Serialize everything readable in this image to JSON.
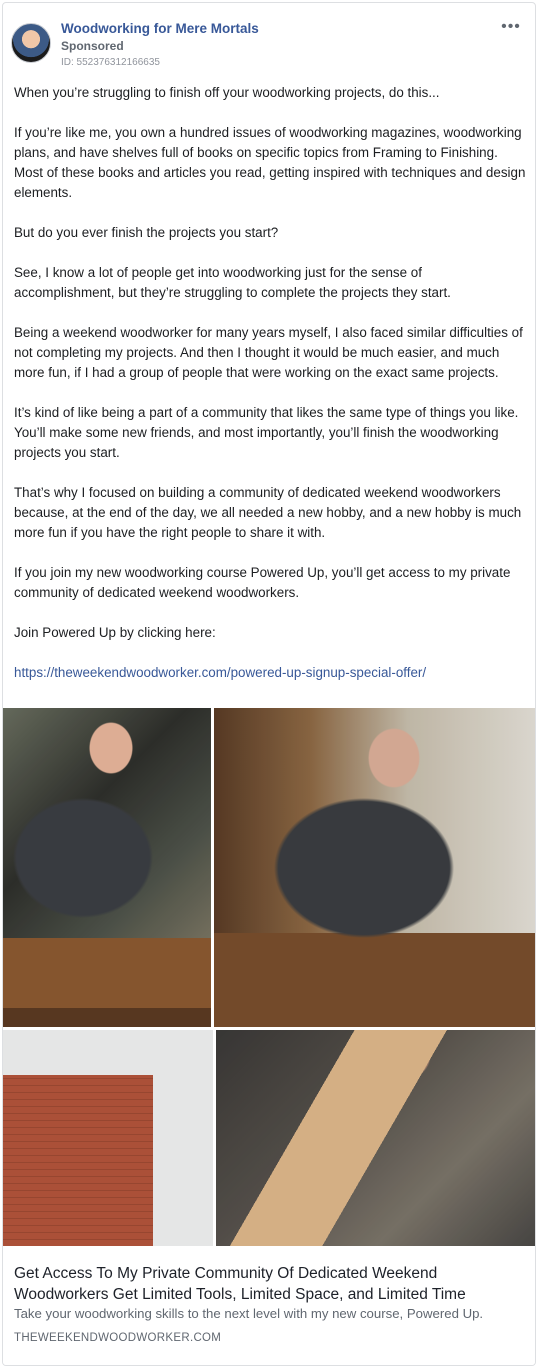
{
  "header": {
    "page_name": "Woodworking for Mere Mortals",
    "sponsored": "Sponsored",
    "ad_id": "ID: 552376312166635",
    "more_icon": "more-horizontal-icon",
    "more_label": "•••"
  },
  "body": {
    "paragraphs": [
      "When you’re struggling to finish off your woodworking projects, do this...",
      "If you’re like me, you own a hundred issues of woodworking magazines, woodworking plans, and have shelves full of books on specific topics from Framing to Finishing. Most of these books and articles you read, getting inspired with techniques and design elements.",
      "But do you ever finish the projects you start?",
      "See, I know a lot of people get into woodworking just for the sense of accomplishment, but they’re struggling to complete the projects they start.",
      "Being a weekend woodworker for many years myself, I also faced similar difficulties of not completing my projects. And then I thought it would be much easier, and much more fun, if I had a group of people that were working on the exact same projects.",
      "It’s kind of like being a part of a community that likes the same type of things you like. You’ll make some new friends, and most importantly, you’ll finish the woodworking projects you start.",
      "That’s why I focused on building a community of dedicated weekend woodworkers because, at the end of the day, we all needed a new hobby, and a new hobby is much more fun if you have the right people to share it with.",
      "If you join my new woodworking course Powered Up, you’ll get access to my private community of dedicated weekend woodworkers.",
      "Join Powered Up by clicking here:"
    ],
    "link": "https://theweekendwoodworker.com/powered-up-signup-special-offer/"
  },
  "images": [
    {
      "name": "photo-man-pipe-lamp"
    },
    {
      "name": "photo-man-drawing-plans"
    },
    {
      "name": "photo-brick-building"
    },
    {
      "name": "photo-man-holding-wood"
    }
  ],
  "preview": {
    "headline": "Get Access To My Private Community Of Dedicated Weekend Woodworkers Get Limited Tools, Limited Space, and Limited Time",
    "description": "Take your woodworking skills to the next level with my new course, Powered Up.",
    "domain": "THEWEEKENDWOODWORKER.COM"
  }
}
